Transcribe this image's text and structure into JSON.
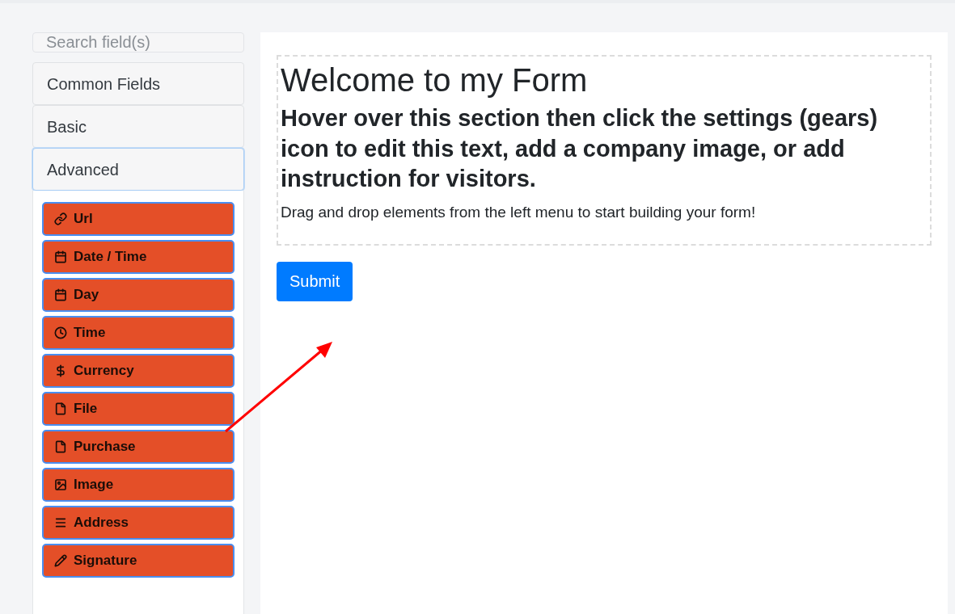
{
  "sidebar": {
    "search": {
      "placeholder": "Search field(s)"
    },
    "sections": [
      {
        "label": "Common Fields",
        "expanded": false
      },
      {
        "label": "Basic",
        "expanded": false
      },
      {
        "label": "Advanced",
        "expanded": true,
        "fields": [
          {
            "kind": "url",
            "label": "Url"
          },
          {
            "kind": "date_time",
            "label": "Date / Time"
          },
          {
            "kind": "day",
            "label": "Day"
          },
          {
            "kind": "time",
            "label": "Time"
          },
          {
            "kind": "currency",
            "label": "Currency"
          },
          {
            "kind": "file",
            "label": "File"
          },
          {
            "kind": "purchase",
            "label": "Purchase"
          },
          {
            "kind": "image",
            "label": "Image"
          },
          {
            "kind": "address",
            "label": "Address"
          },
          {
            "kind": "signature",
            "label": "Signature"
          }
        ]
      }
    ]
  },
  "form": {
    "title": "Welcome to my Form",
    "subtitle": "Hover over this section then click the settings (gears) icon to edit this text, add a company image, or add instruction for visitors.",
    "description": "Drag and drop elements from the left menu to start building your form!",
    "submit": "Submit"
  }
}
